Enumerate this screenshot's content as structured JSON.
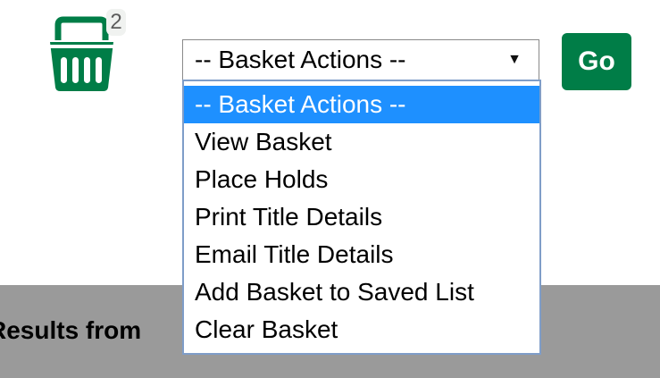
{
  "basket": {
    "icon": "basket-icon",
    "count": "2",
    "color": "#007d47"
  },
  "actions": {
    "select_value": "-- Basket Actions --",
    "options": [
      {
        "label": "-- Basket Actions --"
      },
      {
        "label": "View Basket"
      },
      {
        "label": "Place Holds"
      },
      {
        "label": "Print Title Details"
      },
      {
        "label": "Email Title Details"
      },
      {
        "label": "Add Basket to Saved List"
      },
      {
        "label": "Clear Basket"
      }
    ],
    "go_label": "Go",
    "go_color": "#007d47",
    "highlight_color": "#1e90ff"
  },
  "results": {
    "label": "Results from"
  }
}
